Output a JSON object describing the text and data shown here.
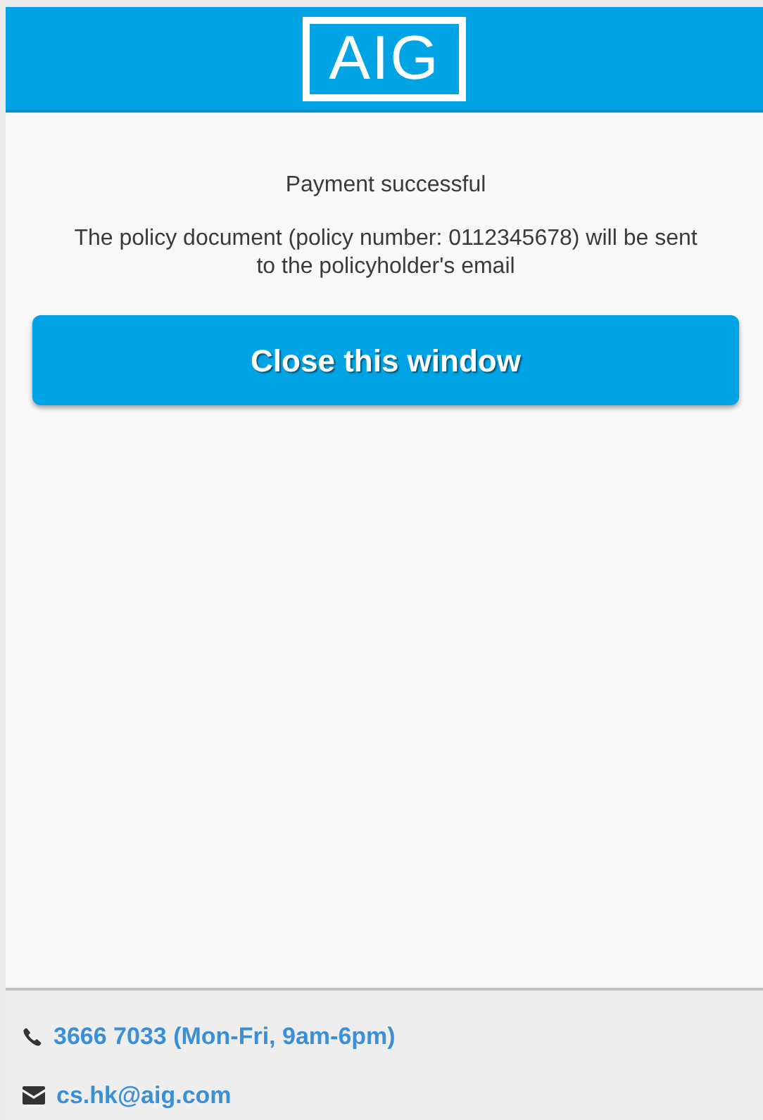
{
  "header": {
    "logo": "AIG"
  },
  "message": {
    "title": "Payment successful",
    "body": "The policy document (policy number: 0112345678) will be sent to the policyholder's email"
  },
  "close_button": "Close this window",
  "contacts": [
    {
      "kind": "phone",
      "text": "3666 7033 (Mon-Fri, 9am-6pm)"
    },
    {
      "kind": "email",
      "text": "cs.hk@aig.com"
    }
  ]
}
